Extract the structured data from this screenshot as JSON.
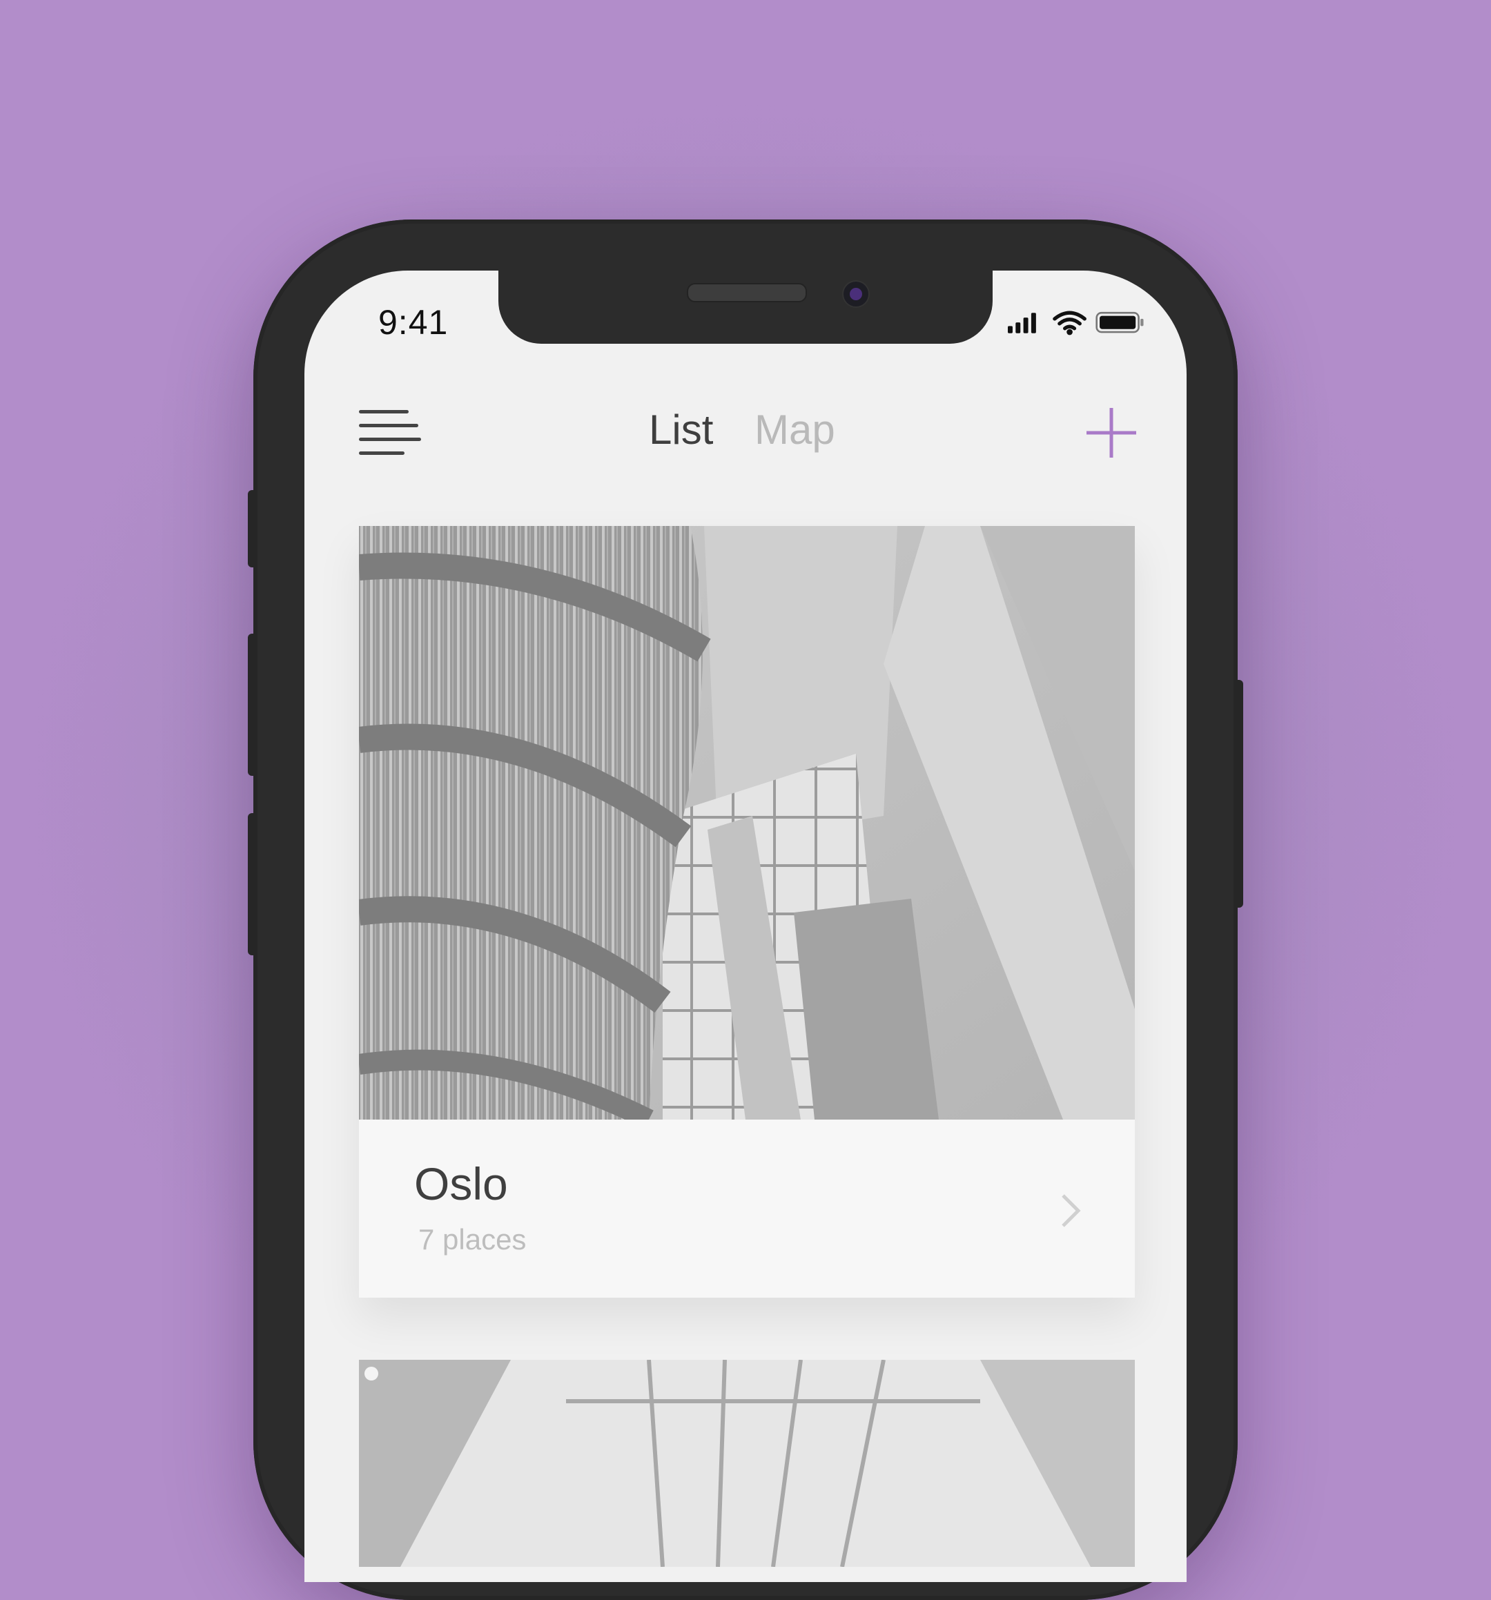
{
  "status_bar": {
    "time": "9:41"
  },
  "nav": {
    "tabs": [
      {
        "label": "List",
        "active": true
      },
      {
        "label": "Map",
        "active": false
      }
    ]
  },
  "cards": [
    {
      "title": "Oslo",
      "subtitle": "7 places"
    }
  ],
  "colors": {
    "background": "#b08aca",
    "accent": "#a97ac8",
    "phone_frame": "#2c2c2c",
    "screen": "#f1f1f1",
    "tab_active": "#3e3e3e",
    "tab_inactive": "#b9b9b9"
  },
  "icons": [
    "menu-icon",
    "plus-icon",
    "chevron-right-icon",
    "signal-icon",
    "wifi-icon",
    "battery-icon"
  ]
}
